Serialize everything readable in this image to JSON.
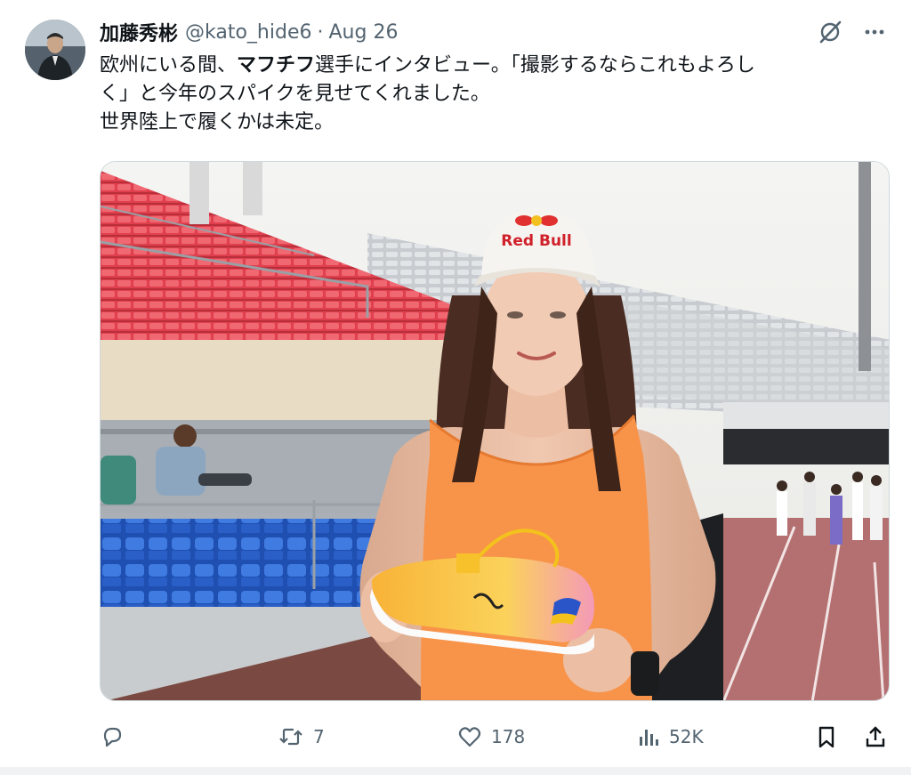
{
  "tweet": {
    "author_name": "加藤秀彬",
    "author_handle": "@kato_hide6",
    "separator": "·",
    "date": "Aug 26",
    "text": {
      "line1_a": "欧州にいる間、",
      "line1_b": "マフチフ",
      "line1_c": "選手にインタビュー。「撮影するならこれもよろし",
      "line2": "く」と今年のスパイクを見せてくれました。",
      "line3": "世界陸上で履くかは未定。"
    },
    "media": {
      "cap_text": "Red Bull"
    }
  },
  "actions": {
    "reply_icon": "reply-icon",
    "retweet_count": "7",
    "like_count": "178",
    "views_count": "52K",
    "bookmark_icon": "bookmark-icon",
    "share_icon": "share-icon"
  },
  "colors": {
    "text_primary": "#0f1419",
    "text_secondary": "#536471",
    "border": "#cfd9de"
  }
}
